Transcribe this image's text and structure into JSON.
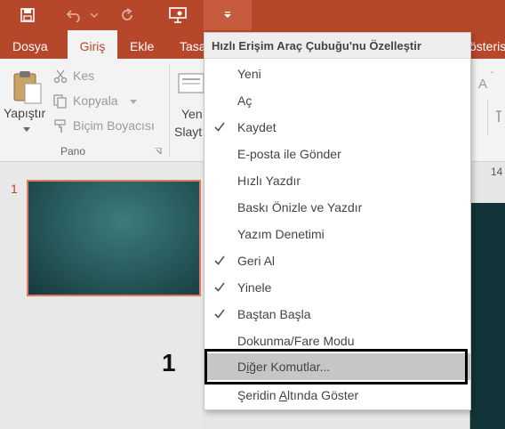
{
  "qat": {
    "save_icon": "floppy-disk-icon",
    "undo_icon": "undo-arrow-icon",
    "redo_icon": "redo-icon",
    "slideshow_icon": "present-from-beginning-icon",
    "customize_icon": "chevron-down-icon"
  },
  "tabs": [
    "Dosya",
    "Giriş",
    "Ekle",
    "Tasa",
    "österis"
  ],
  "ribbon": {
    "paste_label": "Yapıştır",
    "cut_label": "Kes",
    "copy_label": "Kopyala",
    "format_painter_label": "Biçim Boyacısı",
    "clipboard_group": "Pano",
    "new_slide_line1": "Yen",
    "new_slide_line2": "Slayt"
  },
  "thumbnails": {
    "slide_number": "1"
  },
  "ruler_value": "14",
  "annotation_number": "1",
  "menu": {
    "title": "Hızlı Erişim Araç Çubuğu'nu Özelleştir",
    "items": [
      {
        "label": "Yeni",
        "checked": false
      },
      {
        "label": "Aç",
        "checked": false
      },
      {
        "label": "Kaydet",
        "checked": true
      },
      {
        "label": "E-posta ile Gönder",
        "checked": false
      },
      {
        "label": "Hızlı Yazdır",
        "checked": false
      },
      {
        "label": "Baskı Önizle ve Yazdır",
        "checked": false
      },
      {
        "label": "Yazım Denetimi",
        "checked": false
      },
      {
        "label": "Geri Al",
        "checked": true
      },
      {
        "label": "Yinele",
        "checked": true
      },
      {
        "label": "Baştan Başla",
        "checked": true
      },
      {
        "label": "Dokunma/Fare Modu",
        "checked": false
      }
    ],
    "more_commands": {
      "pre": "D",
      "ul": "i",
      "post": "ğer Komutlar..."
    },
    "show_below": {
      "pre": "Şeridin ",
      "ul": "A",
      "post": "ltında Göster"
    }
  },
  "colors": {
    "brand": "#b7472a",
    "highlight": "#c6c6c6",
    "slide_bg": "#2a5f61"
  }
}
